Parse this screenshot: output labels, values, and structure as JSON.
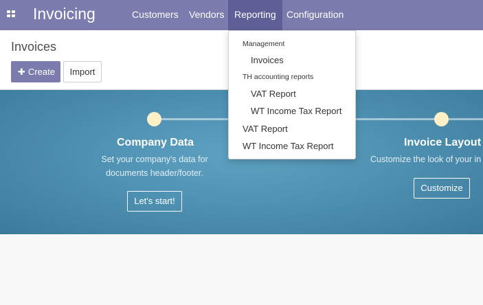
{
  "navbar": {
    "app_title": "Invoicing",
    "menu": [
      {
        "label": "Customers"
      },
      {
        "label": "Vendors"
      },
      {
        "label": "Reporting"
      },
      {
        "label": "Configuration"
      }
    ]
  },
  "control_panel": {
    "breadcrumb": "Invoices",
    "create_label": "Create",
    "import_label": "Import"
  },
  "onboarding": {
    "steps": [
      {
        "title": "Company Data",
        "desc_line1": "Set your company's data for",
        "desc_line2": "documents header/footer.",
        "button": "Let's start!"
      },
      {
        "title": "Invoice Layout",
        "desc_line1": "Customize the look of your in",
        "button": "Customize"
      }
    ]
  },
  "reporting_menu": {
    "sections": [
      {
        "header": "Management",
        "items": [
          "Invoices"
        ]
      },
      {
        "header": "TH accounting reports",
        "items": [
          "VAT Report",
          "WT Income Tax Report"
        ]
      }
    ],
    "top_items": [
      "VAT Report",
      "WT Income Tax Report"
    ]
  },
  "colors": {
    "navbar": "#7c7bad",
    "navbar_active": "#5f5e97",
    "onboarding_bg": "#4f91b2",
    "step_dot": "#fdefc6"
  }
}
